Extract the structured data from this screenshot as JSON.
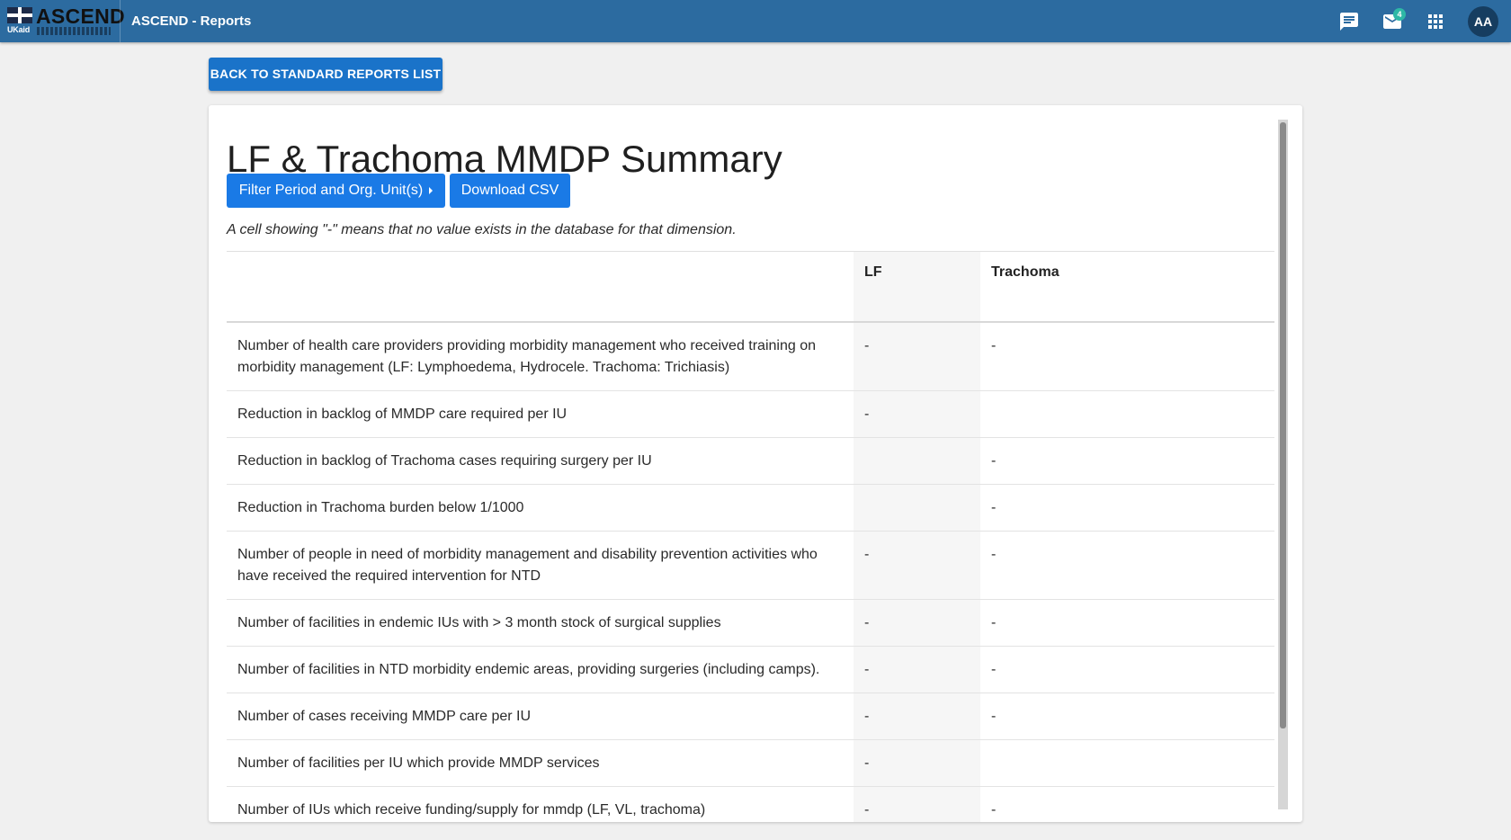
{
  "appbar": {
    "logo_text": "ASCEND",
    "logo_sub": "UKaid",
    "title": "ASCEND - Reports",
    "icons": [
      "chat-icon",
      "mail-icon",
      "apps-grid-icon"
    ],
    "mail_badge": "4",
    "avatar": "AA"
  },
  "back_button": "BACK TO STANDARD REPORTS LIST",
  "report": {
    "title": "LF & Trachoma MMDP Summary",
    "filter_button": "Filter Period and Org. Unit(s)",
    "csv_button": "Download CSV",
    "note": "A cell showing \"-\" means that no value exists in the database for that dimension.",
    "columns": [
      "",
      "LF",
      "Trachoma"
    ],
    "rows": [
      {
        "indicator": "Number of health care providers providing morbidity management who received training on morbidity management (LF: Lymphoedema, Hydrocele. Trachoma: Trichiasis)",
        "lf": "-",
        "trachoma": "-"
      },
      {
        "indicator": "Reduction in backlog of MMDP care required per IU",
        "lf": "-",
        "trachoma": ""
      },
      {
        "indicator": "Reduction in backlog of Trachoma cases requiring surgery per IU",
        "lf": "",
        "trachoma": "-"
      },
      {
        "indicator": "Reduction in Trachoma burden below 1/1000",
        "lf": "",
        "trachoma": "-"
      },
      {
        "indicator": "Number of people in need of morbidity management and disability prevention activities who have received the required intervention for NTD",
        "lf": "-",
        "trachoma": "-"
      },
      {
        "indicator": "Number of facilities in endemic IUs with > 3 month stock of surgical supplies",
        "lf": "-",
        "trachoma": "-"
      },
      {
        "indicator": "Number of facilities in NTD morbidity endemic areas, providing surgeries (including camps).",
        "lf": "-",
        "trachoma": "-"
      },
      {
        "indicator": "Number of cases receiving MMDP care per IU",
        "lf": "-",
        "trachoma": "-"
      },
      {
        "indicator": "Number of facilities per IU which provide MMDP services",
        "lf": "-",
        "trachoma": ""
      },
      {
        "indicator": "Number of IUs which receive funding/supply for mmdp (LF, VL, trachoma)",
        "lf": "-",
        "trachoma": "-"
      }
    ]
  },
  "colors": {
    "appbar": "#2c6ba0",
    "primary_button": "#1a7ae6",
    "back_button": "#1a73c9",
    "badge": "#2eb8a6",
    "avatar": "#163d60"
  }
}
